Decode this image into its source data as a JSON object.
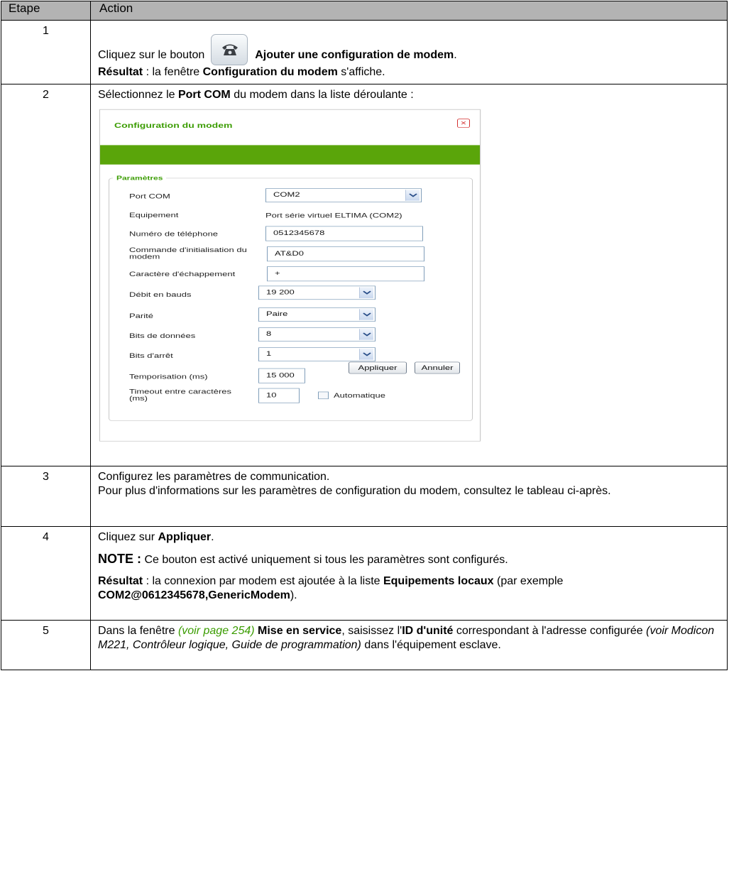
{
  "table": {
    "headers": [
      "Etape",
      "Action"
    ],
    "rows": [
      {
        "num": "1",
        "pre": "Cliquez sur le bouton",
        "bold1": "Ajouter une configuration de modem",
        "after1": ".",
        "result_label": "Résultat",
        "result_text1": " : la fenêtre ",
        "result_bold": "Configuration du modem",
        "result_text2": " s'affiche."
      },
      {
        "num": "2",
        "pre": "Sélectionnez le ",
        "bold1": "Port COM",
        "after1": " du modem dans la liste déroulante :"
      },
      {
        "num": "3",
        "line1": "Configurez les paramètres de communication.",
        "line2": "Pour plus d'informations sur les paramètres de configuration du modem, consultez le tableau ci-après."
      },
      {
        "num": "4",
        "pre": "Cliquez sur ",
        "bold1": "Appliquer",
        "after1": ".",
        "note_label": "NOTE :",
        "note_text": " Ce bouton est activé uniquement si tous les paramètres sont configurés.",
        "result_label": "Résultat",
        "result_text1": " : la connexion par modem est ajoutée à la liste ",
        "result_bold": "Equipements locaux",
        "result_text2": " (par exemple ",
        "result_bold2": "COM2@0612345678,GenericModem",
        "result_text3": ")."
      },
      {
        "num": "5",
        "pre": "Dans la fenêtre ",
        "link": "(voir page 254)",
        "bold1": " Mise en service",
        "mid1": ", saisissez l'",
        "bold2": "ID d'unité",
        "mid2": " correspondant à l'adresse configurée ",
        "ital": "(voir Modicon M221, Contrôleur logique, Guide de programmation)",
        "end": " dans l'équipement esclave."
      }
    ]
  },
  "dialog": {
    "title": "Configuration du modem",
    "legend": "Paramètres",
    "port_com_label": "Port COM",
    "port_com_value": "COM2",
    "equipement_label": "Equipement",
    "equipement_value": "Port série virtuel ELTIMA (COM2)",
    "phone_label": "Numéro de téléphone",
    "phone_value": "0512345678",
    "init_label": "Commande d'initialisation du modem",
    "init_value": "AT&D0",
    "escape_label": "Caractère d'échappement",
    "escape_value": "+",
    "baud_label": "Débit en bauds",
    "baud_value": "19 200",
    "parity_label": "Parité",
    "parity_value": "Paire",
    "databits_label": "Bits de données",
    "databits_value": "8",
    "stopbits_label": "Bits d'arrêt",
    "stopbits_value": "1",
    "tempo_label": "Temporisation (ms)",
    "tempo_value": "15 000",
    "timeout_label": "Timeout entre caractères (ms)",
    "timeout_value": "10",
    "auto_label": "Automatique",
    "apply_label": "Appliquer",
    "cancel_label": "Annuler",
    "band_color": "#5aa50a",
    "title_color": "#3a9c00"
  }
}
